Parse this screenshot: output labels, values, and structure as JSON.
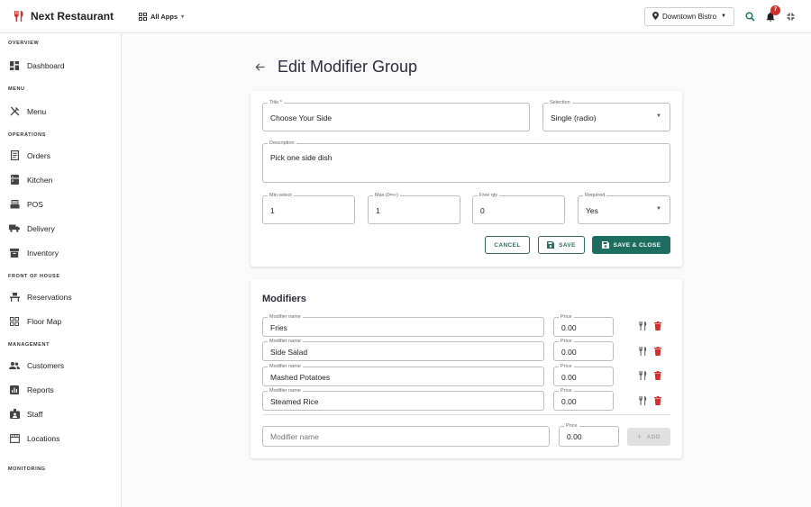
{
  "app": {
    "name": "Next Restaurant",
    "apps_label": "All Apps"
  },
  "topbar": {
    "location": "Downtown Bistro",
    "notifications": "7"
  },
  "sidebar": {
    "sections": [
      {
        "title": "OVERVIEW",
        "items": [
          {
            "label": "Dashboard",
            "icon": "dashboard-icon"
          }
        ]
      },
      {
        "title": "MENU",
        "items": [
          {
            "label": "Menu",
            "icon": "utensils-icon"
          }
        ]
      },
      {
        "title": "OPERATIONS",
        "items": [
          {
            "label": "Orders",
            "icon": "receipt-icon"
          },
          {
            "label": "Kitchen",
            "icon": "kitchen-icon"
          },
          {
            "label": "POS",
            "icon": "register-icon"
          },
          {
            "label": "Delivery",
            "icon": "truck-icon"
          },
          {
            "label": "Inventory",
            "icon": "inventory-icon"
          }
        ]
      },
      {
        "title": "FRONT OF HOUSE",
        "items": [
          {
            "label": "Reservations",
            "icon": "table-icon"
          },
          {
            "label": "Floor Map",
            "icon": "grid-icon"
          }
        ]
      },
      {
        "title": "MANAGEMENT",
        "items": [
          {
            "label": "Customers",
            "icon": "people-icon"
          },
          {
            "label": "Reports",
            "icon": "chart-icon"
          },
          {
            "label": "Staff",
            "icon": "badge-icon"
          },
          {
            "label": "Locations",
            "icon": "store-icon"
          }
        ]
      },
      {
        "title": "MONITORING",
        "items": []
      }
    ]
  },
  "page": {
    "title": "Edit Modifier Group"
  },
  "form": {
    "title_label": "Title *",
    "title_value": "Choose Your Side",
    "selection_label": "Selection",
    "selection_value": "Single (radio)",
    "description_label": "Description",
    "description_value": "Pick one side dish",
    "min_label": "Min select",
    "min_value": "1",
    "max_label": "Max (0=∞)",
    "max_value": "1",
    "free_label": "Free qty",
    "free_value": "0",
    "required_label": "Required",
    "required_value": "Yes",
    "cancel": "CANCEL",
    "save": "SAVE",
    "save_close": "SAVE & CLOSE"
  },
  "modifiers": {
    "title": "Modifiers",
    "name_label": "Modifier name",
    "price_label": "Price",
    "rows": [
      {
        "name": "Fries",
        "price": "0.00"
      },
      {
        "name": "Side Salad",
        "price": "0.00"
      },
      {
        "name": "Mashed Potatoes",
        "price": "0.00"
      },
      {
        "name": "Steamed Rice",
        "price": "0.00"
      }
    ],
    "new_placeholder": "Modifier name",
    "new_price": "0.00",
    "add": "ADD"
  },
  "colors": {
    "primary": "#1d6e61",
    "danger": "#d32f2f",
    "brand_icon": "#d32f2f"
  }
}
